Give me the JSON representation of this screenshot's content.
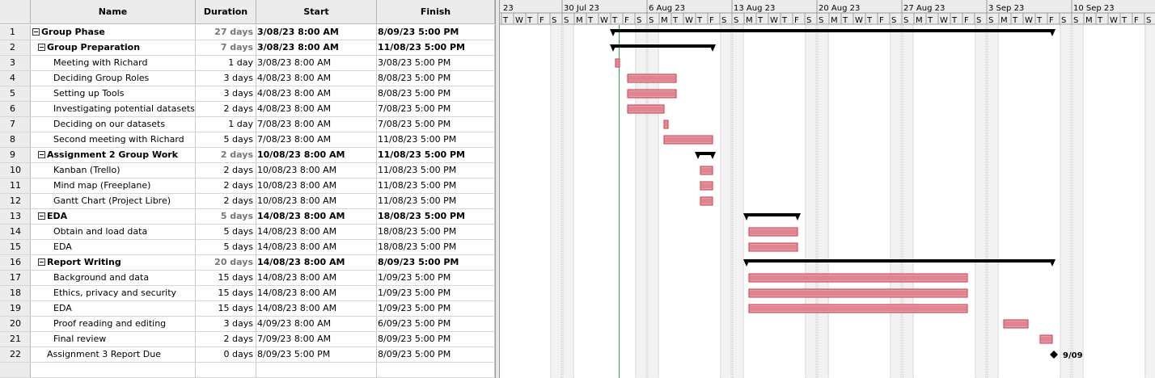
{
  "columns": {
    "id": "",
    "name": "Name",
    "duration": "Duration",
    "start": "Start",
    "finish": "Finish"
  },
  "tasks": [
    {
      "id": "1",
      "name": "Group Phase",
      "duration": "27 days",
      "start": "3/08/23 8:00 AM",
      "finish": "8/09/23 5:00 PM",
      "summary": true,
      "level": 0
    },
    {
      "id": "2",
      "name": "Group Preparation",
      "duration": "7 days",
      "start": "3/08/23 8:00 AM",
      "finish": "11/08/23 5:00 PM",
      "summary": true,
      "level": 1
    },
    {
      "id": "3",
      "name": "Meeting with Richard",
      "duration": "1 day",
      "start": "3/08/23 8:00 AM",
      "finish": "3/08/23 5:00 PM",
      "summary": false,
      "level": 2
    },
    {
      "id": "4",
      "name": "Deciding Group Roles",
      "duration": "3 days",
      "start": "4/08/23 8:00 AM",
      "finish": "8/08/23 5:00 PM",
      "summary": false,
      "level": 2
    },
    {
      "id": "5",
      "name": "Setting up Tools",
      "duration": "3 days",
      "start": "4/08/23 8:00 AM",
      "finish": "8/08/23 5:00 PM",
      "summary": false,
      "level": 2
    },
    {
      "id": "6",
      "name": "Investigating potential datasets",
      "duration": "2 days",
      "start": "4/08/23 8:00 AM",
      "finish": "7/08/23 5:00 PM",
      "summary": false,
      "level": 2
    },
    {
      "id": "7",
      "name": "Deciding on our datasets",
      "duration": "1 day",
      "start": "7/08/23 8:00 AM",
      "finish": "7/08/23 5:00 PM",
      "summary": false,
      "level": 2
    },
    {
      "id": "8",
      "name": "Second meeting with Richard",
      "duration": "5 days",
      "start": "7/08/23 8:00 AM",
      "finish": "11/08/23 5:00 PM",
      "summary": false,
      "level": 2
    },
    {
      "id": "9",
      "name": "Assignment 2 Group Work",
      "duration": "2 days",
      "start": "10/08/23 8:00 AM",
      "finish": "11/08/23 5:00 PM",
      "summary": true,
      "level": 1
    },
    {
      "id": "10",
      "name": "Kanban (Trello)",
      "duration": "2 days",
      "start": "10/08/23 8:00 AM",
      "finish": "11/08/23 5:00 PM",
      "summary": false,
      "level": 2
    },
    {
      "id": "11",
      "name": "Mind map (Freeplane)",
      "duration": "2 days",
      "start": "10/08/23 8:00 AM",
      "finish": "11/08/23 5:00 PM",
      "summary": false,
      "level": 2
    },
    {
      "id": "12",
      "name": "Gantt Chart (Project Libre)",
      "duration": "2 days",
      "start": "10/08/23 8:00 AM",
      "finish": "11/08/23 5:00 PM",
      "summary": false,
      "level": 2
    },
    {
      "id": "13",
      "name": "EDA",
      "duration": "5 days",
      "start": "14/08/23 8:00 AM",
      "finish": "18/08/23 5:00 PM",
      "summary": true,
      "level": 1
    },
    {
      "id": "14",
      "name": "Obtain and load data",
      "duration": "5 days",
      "start": "14/08/23 8:00 AM",
      "finish": "18/08/23 5:00 PM",
      "summary": false,
      "level": 2
    },
    {
      "id": "15",
      "name": "EDA",
      "duration": "5 days",
      "start": "14/08/23 8:00 AM",
      "finish": "18/08/23 5:00 PM",
      "summary": false,
      "level": 2
    },
    {
      "id": "16",
      "name": "Report Writing",
      "duration": "20 days",
      "start": "14/08/23 8:00 AM",
      "finish": "8/09/23 5:00 PM",
      "summary": true,
      "level": 1
    },
    {
      "id": "17",
      "name": "Background and data",
      "duration": "15 days",
      "start": "14/08/23 8:00 AM",
      "finish": "1/09/23 5:00 PM",
      "summary": false,
      "level": 2
    },
    {
      "id": "18",
      "name": "Ethics, privacy and security",
      "duration": "15 days",
      "start": "14/08/23 8:00 AM",
      "finish": "1/09/23 5:00 PM",
      "summary": false,
      "level": 2
    },
    {
      "id": "19",
      "name": "EDA",
      "duration": "15 days",
      "start": "14/08/23 8:00 AM",
      "finish": "1/09/23 5:00 PM",
      "summary": false,
      "level": 2
    },
    {
      "id": "20",
      "name": "Proof reading and editing",
      "duration": "3 days",
      "start": "4/09/23 8:00 AM",
      "finish": "6/09/23 5:00 PM",
      "summary": false,
      "level": 2
    },
    {
      "id": "21",
      "name": "Final review",
      "duration": "2 days",
      "start": "7/09/23 8:00 AM",
      "finish": "8/09/23 5:00 PM",
      "summary": false,
      "level": 2
    },
    {
      "id": "22",
      "name": "Assignment 3 Report Due",
      "duration": "0 days",
      "start": "8/09/23 5:00 PM",
      "finish": "8/09/23 5:00 PM",
      "summary": false,
      "milestone": true,
      "level": 1
    }
  ],
  "timeline": {
    "weeks": [
      "23",
      "30 Jul 23",
      "6 Aug 23",
      "13 Aug 23",
      "20 Aug 23",
      "27 Aug 23",
      "3 Sep 23",
      "10 Sep 23"
    ],
    "first_day": "2023-07-25",
    "day_letters": [
      "S",
      "M",
      "T",
      "W",
      "T",
      "F",
      "S"
    ],
    "milestone_label": "9/09",
    "colors": {
      "task_bar": "#cc3344",
      "summary_bar": "#000000",
      "weekend": "#c8c8c8",
      "today_line": "#22aa44"
    },
    "today": "2023-08-03"
  },
  "chart_data": {
    "type": "gantt",
    "bars": [
      {
        "task": "Group Phase",
        "start": "2023-08-03",
        "end": "2023-09-08",
        "kind": "summary"
      },
      {
        "task": "Group Preparation",
        "start": "2023-08-03",
        "end": "2023-08-11",
        "kind": "summary"
      },
      {
        "task": "Meeting with Richard",
        "start": "2023-08-03",
        "end": "2023-08-03",
        "kind": "task"
      },
      {
        "task": "Deciding Group Roles",
        "start": "2023-08-04",
        "end": "2023-08-08",
        "kind": "task"
      },
      {
        "task": "Setting up Tools",
        "start": "2023-08-04",
        "end": "2023-08-08",
        "kind": "task"
      },
      {
        "task": "Investigating potential datasets",
        "start": "2023-08-04",
        "end": "2023-08-07",
        "kind": "task"
      },
      {
        "task": "Deciding on our datasets",
        "start": "2023-08-07",
        "end": "2023-08-07",
        "kind": "task"
      },
      {
        "task": "Second meeting with Richard",
        "start": "2023-08-07",
        "end": "2023-08-11",
        "kind": "task"
      },
      {
        "task": "Assignment 2 Group Work",
        "start": "2023-08-10",
        "end": "2023-08-11",
        "kind": "summary"
      },
      {
        "task": "Kanban (Trello)",
        "start": "2023-08-10",
        "end": "2023-08-11",
        "kind": "task"
      },
      {
        "task": "Mind map (Freeplane)",
        "start": "2023-08-10",
        "end": "2023-08-11",
        "kind": "task"
      },
      {
        "task": "Gantt Chart (Project Libre)",
        "start": "2023-08-10",
        "end": "2023-08-11",
        "kind": "task"
      },
      {
        "task": "EDA",
        "start": "2023-08-14",
        "end": "2023-08-18",
        "kind": "summary"
      },
      {
        "task": "Obtain and load data",
        "start": "2023-08-14",
        "end": "2023-08-18",
        "kind": "task"
      },
      {
        "task": "EDA",
        "start": "2023-08-14",
        "end": "2023-08-18",
        "kind": "task"
      },
      {
        "task": "Report Writing",
        "start": "2023-08-14",
        "end": "2023-09-08",
        "kind": "summary"
      },
      {
        "task": "Background and data",
        "start": "2023-08-14",
        "end": "2023-09-01",
        "kind": "task"
      },
      {
        "task": "Ethics, privacy and security",
        "start": "2023-08-14",
        "end": "2023-09-01",
        "kind": "task"
      },
      {
        "task": "EDA",
        "start": "2023-08-14",
        "end": "2023-09-01",
        "kind": "task"
      },
      {
        "task": "Proof reading and editing",
        "start": "2023-09-04",
        "end": "2023-09-06",
        "kind": "task"
      },
      {
        "task": "Final review",
        "start": "2023-09-07",
        "end": "2023-09-08",
        "kind": "task"
      },
      {
        "task": "Assignment 3 Report Due",
        "start": "2023-09-08",
        "end": "2023-09-08",
        "kind": "milestone"
      }
    ]
  }
}
